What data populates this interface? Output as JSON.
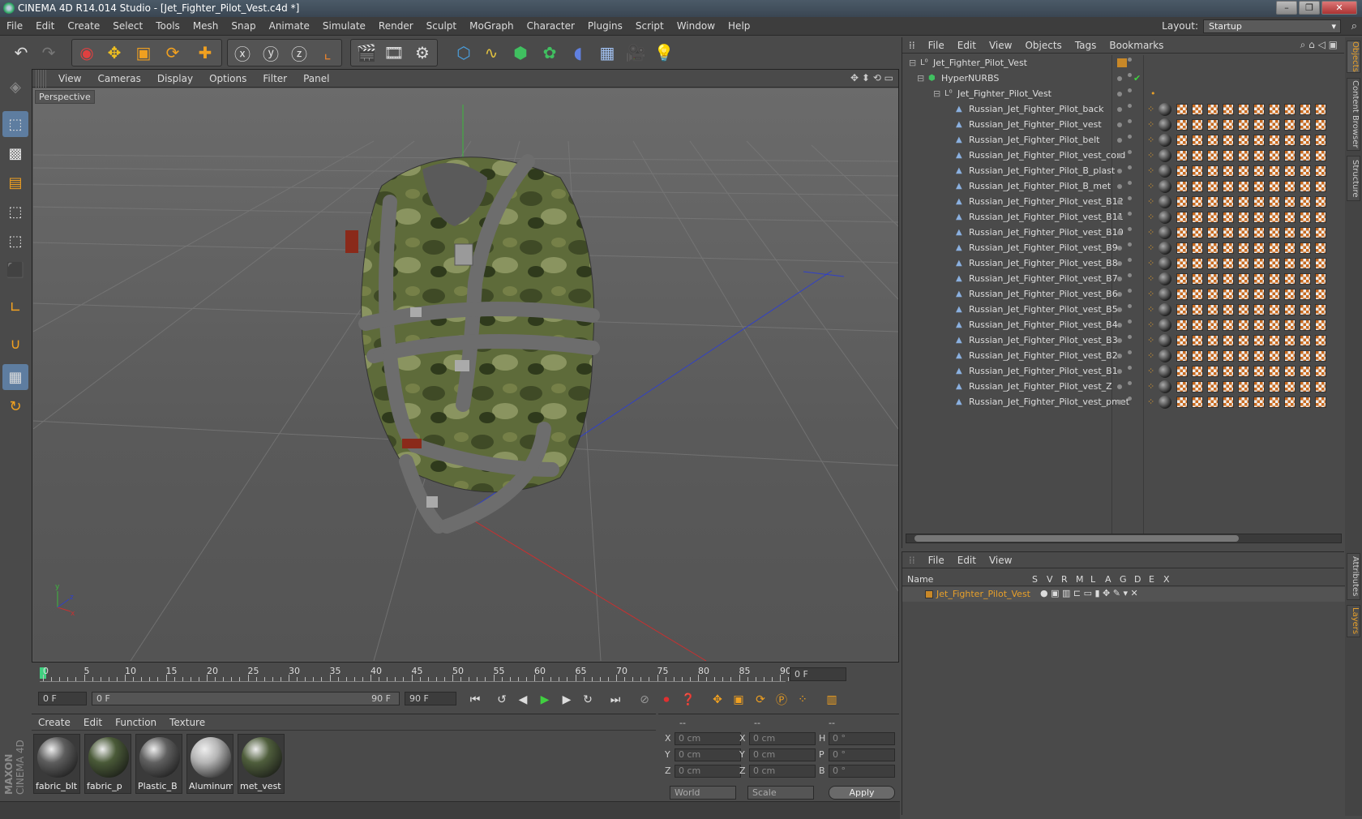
{
  "window": {
    "title": "CINEMA 4D R14.014 Studio - [Jet_Fighter_Pilot_Vest.c4d *]"
  },
  "menubar": {
    "items": [
      "File",
      "Edit",
      "Create",
      "Select",
      "Tools",
      "Mesh",
      "Snap",
      "Animate",
      "Simulate",
      "Render",
      "Sculpt",
      "MoGraph",
      "Character",
      "Plugins",
      "Script",
      "Window",
      "Help"
    ],
    "layout_label": "Layout:",
    "layout_value": "Startup"
  },
  "viewport": {
    "menu": [
      "View",
      "Cameras",
      "Display",
      "Options",
      "Filter",
      "Panel"
    ],
    "camera_label": "Perspective"
  },
  "timeline": {
    "ticks": [
      "0",
      "5",
      "10",
      "15",
      "20",
      "25",
      "30",
      "35",
      "40",
      "45",
      "50",
      "55",
      "60",
      "65",
      "70",
      "75",
      "80",
      "85",
      "90"
    ],
    "current_frame": "0 F"
  },
  "transport": {
    "start_field": "0 F",
    "range_left": "0 F",
    "range_right": "90 F",
    "end_field": "90 F"
  },
  "materials": {
    "menu": [
      "Create",
      "Edit",
      "Function",
      "Texture"
    ],
    "items": [
      {
        "label": "fabric_blt",
        "color": "#5d5d5d"
      },
      {
        "label": "fabric_p",
        "color": "#4a5a38"
      },
      {
        "label": "Plastic_B",
        "color": "#606060"
      },
      {
        "label": "Aluminum_",
        "color": "#b5b5b5"
      },
      {
        "label": "met_vest",
        "color": "#4f5e3c"
      }
    ],
    "brand_top": "MAXON",
    "brand_bottom": "CINEMA 4D"
  },
  "coords": {
    "headers": [
      "--",
      "--",
      "--"
    ],
    "rows": [
      {
        "a": "X",
        "av": "0 cm",
        "b": "X",
        "bv": "0 cm",
        "c": "H",
        "cv": "0 °"
      },
      {
        "a": "Y",
        "av": "0 cm",
        "b": "Y",
        "bv": "0 cm",
        "c": "P",
        "cv": "0 °"
      },
      {
        "a": "Z",
        "av": "0 cm",
        "b": "Z",
        "bv": "0 cm",
        "c": "B",
        "cv": "0 °"
      }
    ],
    "world": "World",
    "scale": "Scale",
    "apply": "Apply"
  },
  "objects": {
    "menu": [
      "File",
      "Edit",
      "View",
      "Objects",
      "Tags",
      "Bookmarks"
    ],
    "root": "Jet_Fighter_Pilot_Vest",
    "hypernurbs": "HyperNURBS",
    "group": "Jet_Fighter_Pilot_Vest",
    "children": [
      "Russian_Jet_Fighter_Pilot_back",
      "Russian_Jet_Fighter_Pilot_vest",
      "Russian_Jet_Fighter_Pilot_belt",
      "Russian_Jet_Fighter_Pilot_vest_cord",
      "Russian_Jet_Fighter_Pilot_B_plast",
      "Russian_Jet_Fighter_Pilot_B_met",
      "Russian_Jet_Fighter_Pilot_vest_B12",
      "Russian_Jet_Fighter_Pilot_vest_B11",
      "Russian_Jet_Fighter_Pilot_vest_B10",
      "Russian_Jet_Fighter_Pilot_vest_B9",
      "Russian_Jet_Fighter_Pilot_vest_B8",
      "Russian_Jet_Fighter_Pilot_vest_B7",
      "Russian_Jet_Fighter_Pilot_vest_B6",
      "Russian_Jet_Fighter_Pilot_vest_B5",
      "Russian_Jet_Fighter_Pilot_vest_B4",
      "Russian_Jet_Fighter_Pilot_vest_B3",
      "Russian_Jet_Fighter_Pilot_vest_B2",
      "Russian_Jet_Fighter_Pilot_vest_B1",
      "Russian_Jet_Fighter_Pilot_vest_Z",
      "Russian_Jet_Fighter_Pilot_vest_pmet"
    ]
  },
  "layers": {
    "menu": [
      "File",
      "Edit",
      "View"
    ],
    "columns": [
      "Name",
      "S",
      "V",
      "R",
      "M",
      "L",
      "A",
      "G",
      "D",
      "E",
      "X"
    ],
    "row": "Jet_Fighter_Pilot_Vest",
    "accent": "#e8a02a"
  },
  "side_tabs": [
    "Objects",
    "Content Browser",
    "Structure",
    "Attributes",
    "Layers"
  ]
}
